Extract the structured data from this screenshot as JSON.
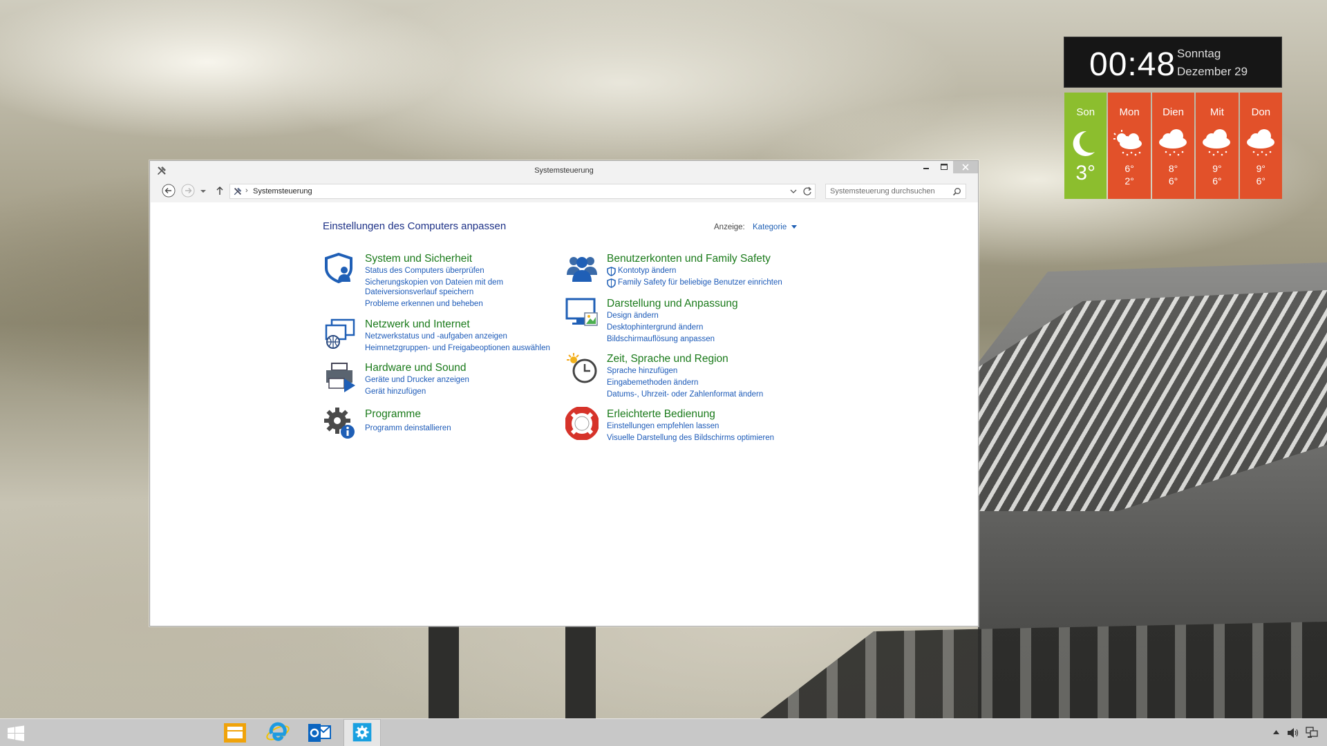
{
  "widgets": {
    "clock": {
      "time": "00:48",
      "day": "Sonntag",
      "date": "Dezember 29"
    },
    "weather": [
      {
        "day": "Son",
        "temp": "3°",
        "condition": "moon-icon",
        "today": true
      },
      {
        "day": "Mon",
        "high": "6°",
        "low": "2°",
        "condition": "partly-cloudy-rain-icon"
      },
      {
        "day": "Dien",
        "high": "8°",
        "low": "6°",
        "condition": "rain-cloud-icon"
      },
      {
        "day": "Mit",
        "high": "9°",
        "low": "6°",
        "condition": "rain-cloud-icon"
      },
      {
        "day": "Don",
        "high": "9°",
        "low": "6°",
        "condition": "rain-cloud-icon"
      }
    ]
  },
  "window": {
    "title": "Systemsteuerung",
    "address": {
      "path": "Systemsteuerung"
    },
    "search": {
      "placeholder": "Systemsteuerung durchsuchen"
    }
  },
  "content": {
    "heading": "Einstellungen des Computers anpassen",
    "view_label": "Anzeige:",
    "view_value": "Kategorie",
    "categories": [
      {
        "title": "System und Sicherheit",
        "icon": "security-shield-icon",
        "links": [
          "Status des Computers überprüfen",
          "Sicherungskopien von Dateien mit dem",
          "Dateiversionsverlauf speichern",
          "Probleme erkennen und beheben"
        ]
      },
      {
        "title": "Netzwerk und Internet",
        "icon": "network-icon",
        "links": [
          "Netzwerkstatus und -aufgaben anzeigen",
          "Heimnetzgruppen- und Freigabeoptionen auswählen"
        ]
      },
      {
        "title": "Hardware und Sound",
        "icon": "printer-icon",
        "links": [
          "Geräte und Drucker anzeigen",
          "Gerät hinzufügen"
        ]
      },
      {
        "title": "Programme",
        "icon": "programs-gear-icon",
        "links": [
          "Programm deinstallieren"
        ]
      },
      {
        "title": "Benutzerkonten und Family Safety",
        "icon": "users-icon",
        "links": [
          "Kontotyp ändern",
          "Family Safety für beliebige Benutzer einrichten"
        ]
      },
      {
        "title": "Darstellung und Anpassung",
        "icon": "display-icon",
        "links": [
          "Design ändern",
          "Desktophintergrund ändern",
          "Bildschirmauflösung anpassen"
        ]
      },
      {
        "title": "Zeit, Sprache und Region",
        "icon": "clock-globe-icon",
        "links": [
          "Sprache hinzufügen",
          "Eingabemethoden ändern",
          "Datums-, Uhrzeit- oder Zahlenformat ändern"
        ]
      },
      {
        "title": "Erleichterte Bedienung",
        "icon": "lifebuoy-icon",
        "links": [
          "Einstellungen empfehlen lassen",
          "Visuelle Darstellung des Bildschirms optimieren"
        ]
      }
    ]
  },
  "taskbar": {
    "apps": [
      "file-explorer-icon",
      "internet-explorer-icon",
      "outlook-icon",
      "control-panel-icon"
    ]
  },
  "colors": {
    "accent_link": "#1c5ab8",
    "category_title": "#1a7a1a",
    "weather_today": "#8cbe2e",
    "weather_day": "#e2512a"
  }
}
